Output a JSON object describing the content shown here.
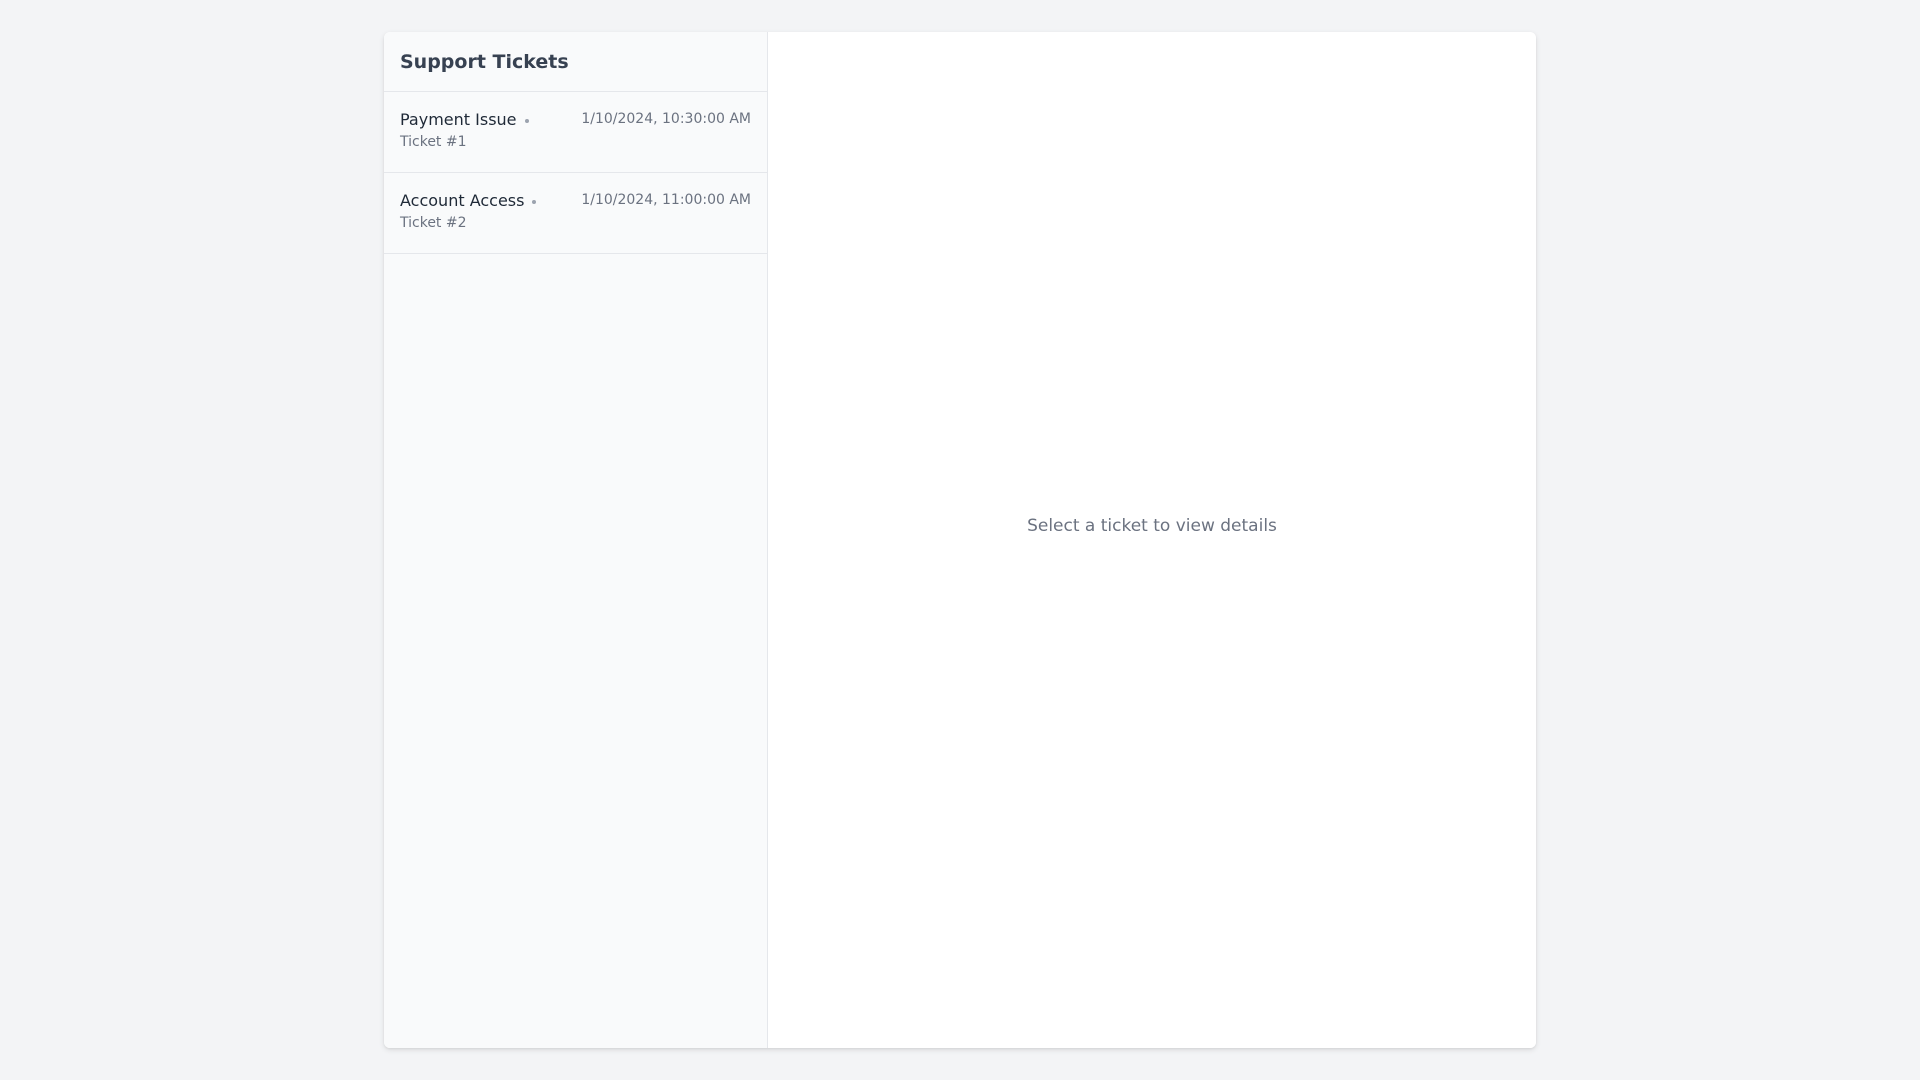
{
  "sidebar": {
    "title": "Support Tickets",
    "tickets": [
      {
        "subject": "Payment Issue",
        "ticket_id": "Ticket #1",
        "timestamp": "1/10/2024, 10:30:00 AM",
        "status_color": "#9ca3af"
      },
      {
        "subject": "Account Access",
        "ticket_id": "Ticket #2",
        "timestamp": "1/10/2024, 11:00:00 AM",
        "status_color": "#9ca3af"
      }
    ]
  },
  "detail": {
    "empty_message": "Select a ticket to view details"
  },
  "colors": {
    "page_background": "#f3f4f6",
    "card_background": "#ffffff",
    "sidebar_background": "#f9fafb",
    "border": "#e5e7eb",
    "muted_text": "#6b7280"
  }
}
